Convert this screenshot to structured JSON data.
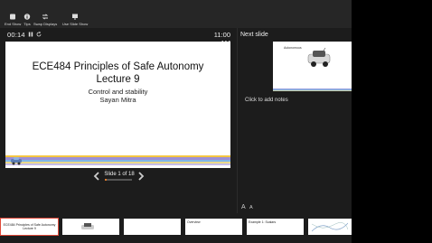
{
  "toolbar": {
    "buttons": [
      {
        "label": "End Show",
        "icon": "end-show-icon"
      },
      {
        "label": "Tips",
        "icon": "info-icon"
      },
      {
        "label": "Swap Displays",
        "icon": "swap-icon"
      },
      {
        "label": "Use Slide Show",
        "icon": "monitor-icon"
      }
    ]
  },
  "timer": {
    "elapsed": "00:14",
    "clock": "11:00 AM"
  },
  "current_slide": {
    "title_line1": "ECE484 Principles of Safe Autonomy",
    "title_line2": "Lecture 9",
    "subtitle_line1": "Control and stability",
    "subtitle_line2": "Sayan Mitra",
    "stripe_colors": [
      "#f4c542",
      "#9b8fd6",
      "#7fb5e8",
      "#e9d88a",
      "#c7bde9"
    ]
  },
  "navigation": {
    "counter": "Slide 1 of 18",
    "progress": 0.06
  },
  "next_slide": {
    "label": "Next slide",
    "thumb_heading": "Autonomous"
  },
  "notes": {
    "placeholder": "Click to add notes"
  },
  "font_controls": {
    "increase": "A",
    "decrease": "A"
  },
  "filmstrip": {
    "thumbs": [
      {
        "text": "ECE484 Principles of Safe Autonomy Lecture 9",
        "active": true
      },
      {
        "text": "",
        "active": false
      },
      {
        "text": "",
        "active": false
      },
      {
        "text": "Overview",
        "active": false
      },
      {
        "text": "Example 1: Scalars",
        "active": false
      },
      {
        "text": "",
        "active": false
      }
    ]
  },
  "colors": {
    "accent": "#e07a2a",
    "active_outline": "#e04a3a"
  }
}
